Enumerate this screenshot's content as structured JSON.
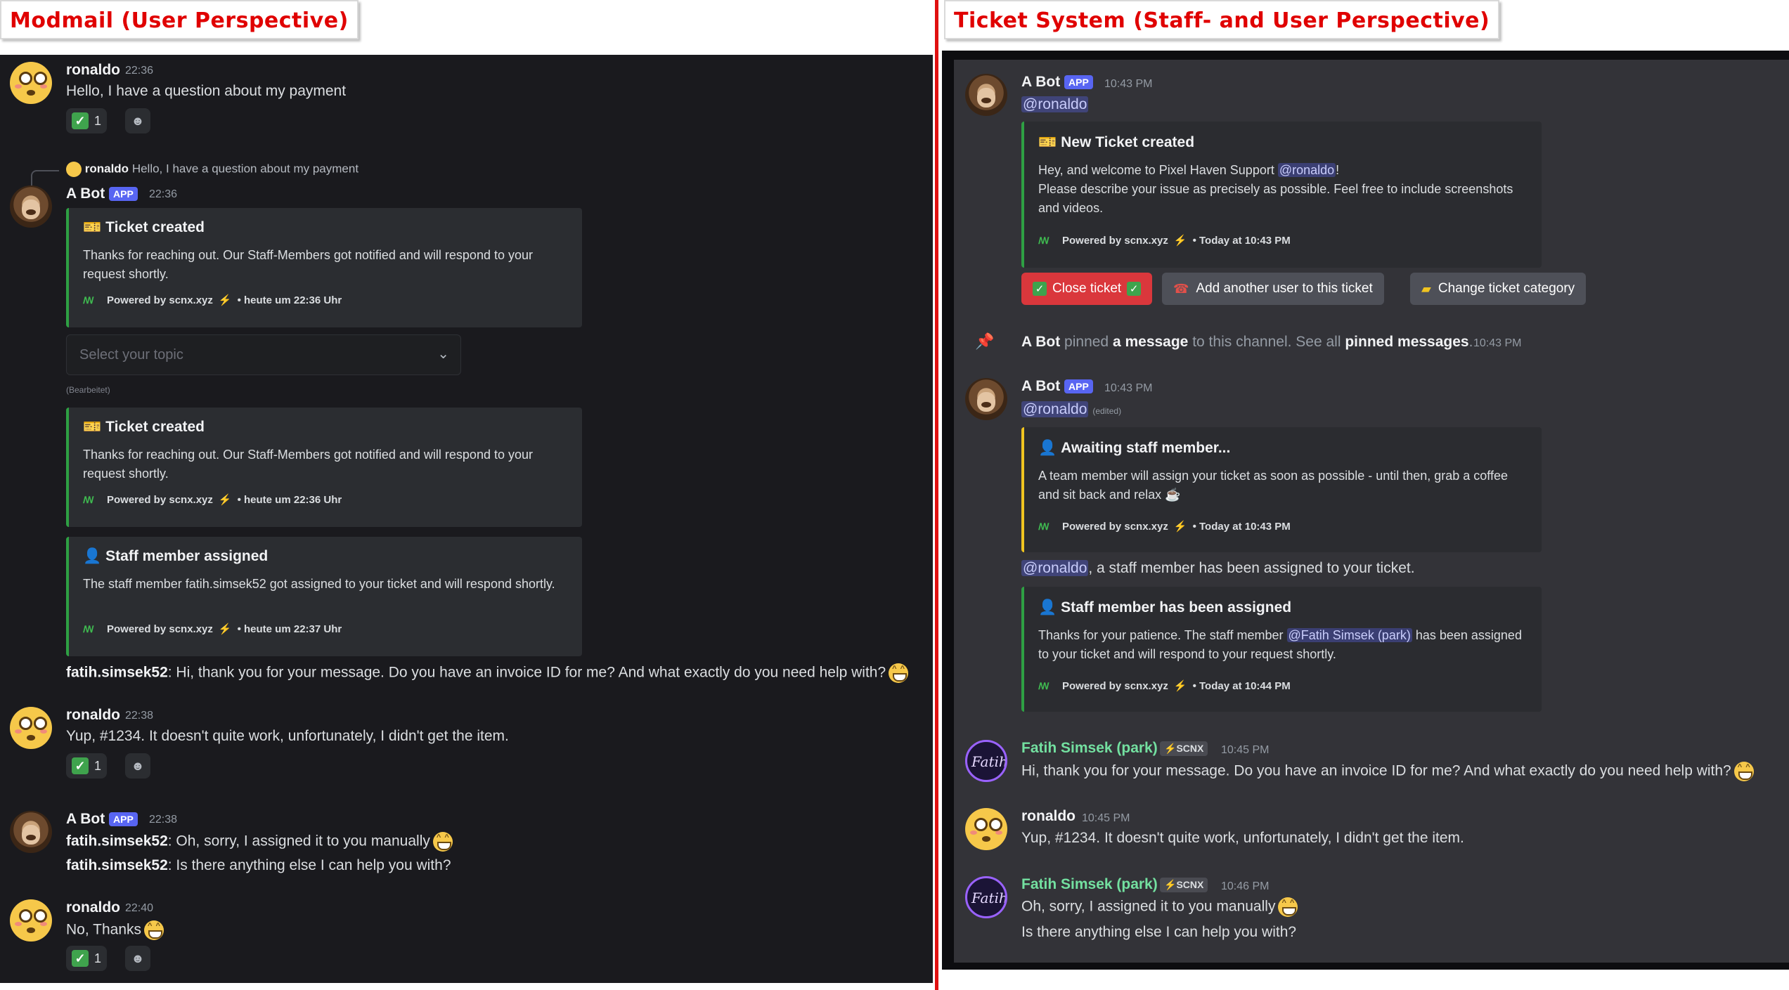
{
  "captions": {
    "left": "Modmail (User Perspective)",
    "right": "Ticket System (Staff- and User Perspective)"
  },
  "left": {
    "msg1": {
      "user": "ronaldo",
      "time": "22:36",
      "text": "Hello, I have a question about my payment",
      "reaction_count": "1"
    },
    "reply": {
      "user": "ronaldo",
      "text": "Hello, I have a question about my payment"
    },
    "bot1": {
      "user": "A Bot",
      "badge": "APP",
      "time": "22:36"
    },
    "embed1": {
      "title": "Ticket created",
      "desc": "Thanks for reaching out. Our Staff-Members got notified and will respond to your request shortly.",
      "footer": "Powered by scnx.xyz",
      "footer_time": "• heute um 22:36 Uhr"
    },
    "select": {
      "placeholder": "Select your topic"
    },
    "edited": "(Bearbeitet)",
    "embed2": {
      "title": "Ticket created",
      "desc": "Thanks for reaching out. Our Staff-Members got notified and will respond to your request shortly.",
      "footer": "Powered by scnx.xyz",
      "footer_time": "• heute um 22:36 Uhr"
    },
    "embed3": {
      "title": "Staff member assigned",
      "desc": "The staff member fatih.simsek52 got assigned to your ticket and will respond shortly.",
      "footer": "Powered by scnx.xyz",
      "footer_time": "• heute um 22:37 Uhr"
    },
    "staff_line1": {
      "name": "fatih.simsek52",
      "text": ": Hi, thank you for your message. Do you have an invoice ID for me? And what exactly do you need help with?"
    },
    "msg2": {
      "user": "ronaldo",
      "time": "22:38",
      "text": "Yup, #1234. It doesn't quite work, unfortunately, I didn't get the item.",
      "reaction_count": "1"
    },
    "bot2": {
      "user": "A Bot",
      "badge": "APP",
      "time": "22:38"
    },
    "staff_line2": {
      "name": "fatih.simsek52",
      "text": ": Oh, sorry, I assigned it to you manually"
    },
    "staff_line3": {
      "name": "fatih.simsek52",
      "text": ": Is there anything else I can help you with?"
    },
    "msg3": {
      "user": "ronaldo",
      "time": "22:40",
      "text": "No, Thanks",
      "reaction_count": "1"
    }
  },
  "right": {
    "bot1": {
      "user": "A Bot",
      "badge": "APP",
      "time": "10:43 PM",
      "mention": "@ronaldo"
    },
    "embed1": {
      "title": "New Ticket created",
      "desc_pre": "Hey, and welcome to Pixel Haven Support ",
      "desc_mention": "@ronaldo",
      "desc_post": "!",
      "desc2": "Please describe your issue as precisely as possible. Feel free to include screenshots and videos.",
      "footer": "Powered by scnx.xyz",
      "footer_time": "• Today at 10:43 PM"
    },
    "buttons": {
      "close": "Close ticket",
      "add_user": "Add another user to this ticket",
      "category": "Change ticket category"
    },
    "pin": {
      "user": "A Bot",
      "t1": " pinned ",
      "t2": "a message",
      "t3": " to this channel. See all ",
      "t4": "pinned messages",
      "t5": ".",
      "time": "10:43 PM"
    },
    "bot2": {
      "user": "A Bot",
      "badge": "APP",
      "time": "10:43 PM",
      "mention": "@ronaldo",
      "edited": "(edited)"
    },
    "embed2": {
      "title": "Awaiting staff member...",
      "desc": "A team member will assign your ticket as soon as possible - until then, grab a coffee and sit back and relax",
      "footer": "Powered by scnx.xyz",
      "footer_time": "• Today at 10:43 PM"
    },
    "assign_line": {
      "mention": "@ronaldo",
      "text": ", a staff member has been assigned to your ticket."
    },
    "embed3": {
      "title": "Staff member has been assigned",
      "desc_pre": "Thanks for your patience. The staff member ",
      "desc_mention": "@Fatih Simsek (park)",
      "desc_post": " has been assigned to your ticket and will respond to your request shortly.",
      "footer": "Powered by scnx.xyz",
      "footer_time": "• Today at 10:44 PM"
    },
    "staff1": {
      "user": "Fatih Simsek (park)",
      "tag": "SCNX",
      "time": "10:45 PM",
      "text": "Hi, thank you for your message. Do you have an invoice ID for me? And what exactly do you need help with?"
    },
    "msg_ronaldo": {
      "user": "ronaldo",
      "time": "10:45 PM",
      "text": "Yup, #1234. It doesn't quite work, unfortunately, I didn't get the item."
    },
    "staff2": {
      "user": "Fatih Simsek (park)",
      "tag": "SCNX",
      "time": "10:46 PM",
      "text1": "Oh, sorry, I assigned it to you manually",
      "text2": "Is there anything else I can help you with?"
    }
  },
  "colors": {
    "accent_red": "#e00000",
    "embed_green": "#2ea043",
    "embed_yellow": "#f0c420",
    "app_badge": "#5865f2",
    "close_button": "#da373c"
  }
}
